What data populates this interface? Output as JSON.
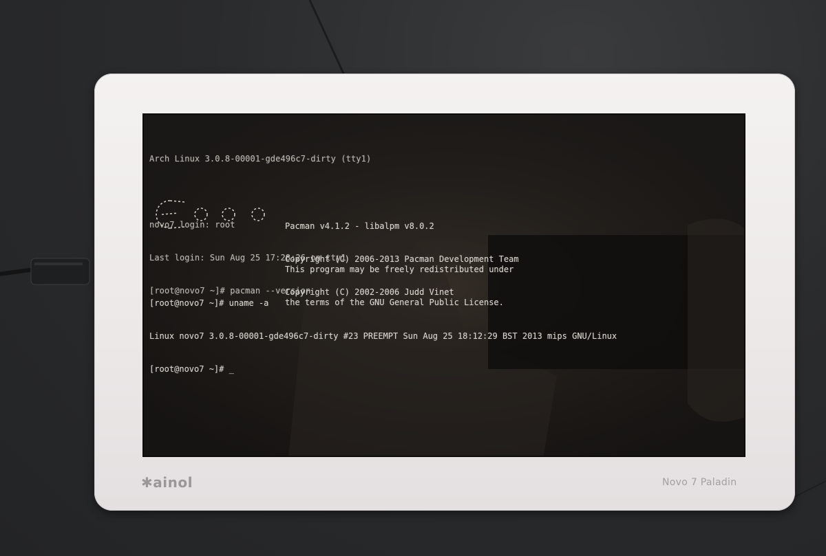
{
  "photo": {
    "subject": "tablet",
    "brand": "ainol",
    "model": "Novo 7 Paladin"
  },
  "terminal": {
    "header": "Arch Linux 3.0.8-00001-gde496c7-dirty (tty1)",
    "login_line": "novo7 login: root",
    "last_login": "Last login: Sun Aug 25 17:28:26 on tty1",
    "prompt_cmd1": "[root@novo7 ~]# pacman --version",
    "pacman_info": [
      "Pacman v4.1.2 - libalpm v8.0.2",
      "Copyright (C) 2006-2013 Pacman Development Team",
      "Copyright (C) 2002-2006 Judd Vinet"
    ],
    "pacman_license": [
      "This program may be freely redistributed under",
      "the terms of the GNU General Public License."
    ],
    "prompt_cmd2": "[root@novo7 ~]# uname -a",
    "uname_output": "Linux novo7 3.0.8-00001-gde496c7-dirty #23 PREEMPT Sun Aug 25 18:12:29 BST 2013 mips GNU/Linux",
    "prompt_final": "[root@novo7 ~]# _"
  },
  "colors": {
    "bezel": "#eeeaea",
    "screen": "#181614",
    "text": "#d8d4cc",
    "desk": "#2b2c2e"
  }
}
